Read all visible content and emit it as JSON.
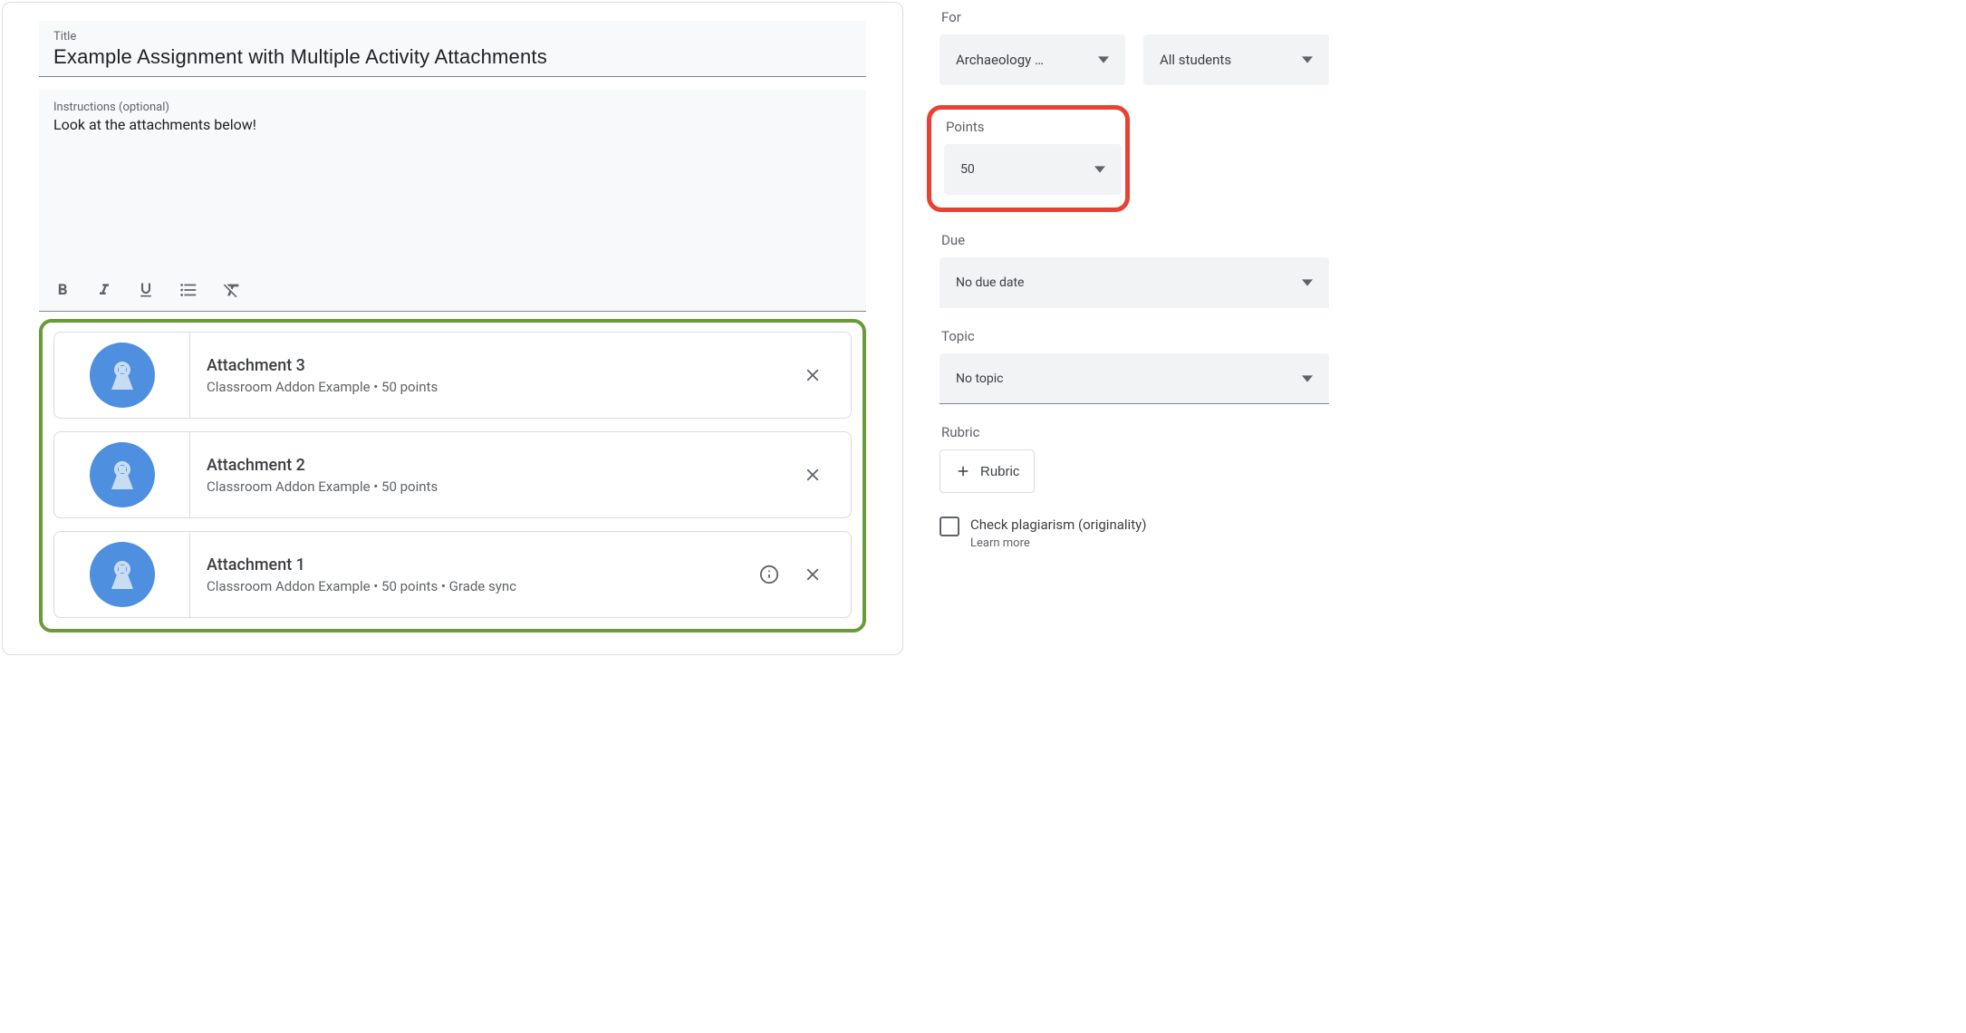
{
  "assignment": {
    "title_label": "Title",
    "title_value": "Example Assignment with Multiple Activity Attachments",
    "instructions_label": "Instructions (optional)",
    "instructions_value": "Look at the attachments below!"
  },
  "attachments": [
    {
      "title": "Attachment 3",
      "subtitle": "Classroom Addon Example • 50 points",
      "has_info": false
    },
    {
      "title": "Attachment 2",
      "subtitle": "Classroom Addon Example • 50 points",
      "has_info": false
    },
    {
      "title": "Attachment 1",
      "subtitle": "Classroom Addon Example • 50 points • Grade sync",
      "has_info": true
    }
  ],
  "sidebar": {
    "for_label": "For",
    "class_value": "Archaeology …",
    "students_value": "All students",
    "points_label": "Points",
    "points_value": "50",
    "due_label": "Due",
    "due_value": "No due date",
    "topic_label": "Topic",
    "topic_value": "No topic",
    "rubric_label": "Rubric",
    "rubric_button": "Rubric",
    "plagiarism_label": "Check plagiarism (originality)",
    "learn_more": "Learn more"
  }
}
